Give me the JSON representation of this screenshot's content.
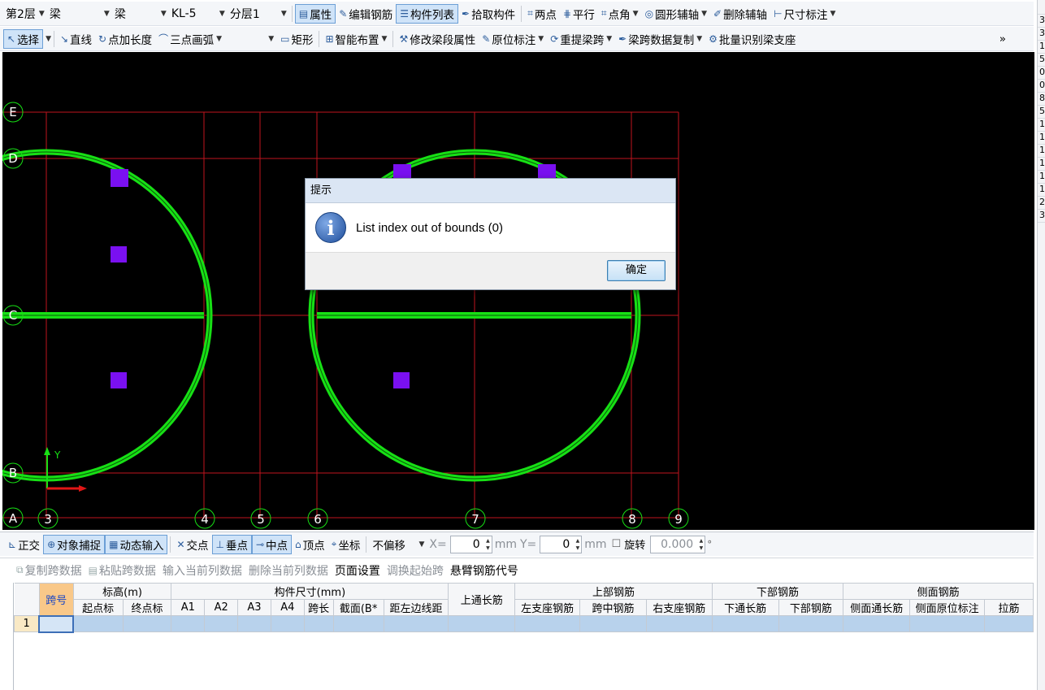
{
  "toolbar1": {
    "floor": "第2层",
    "type1": "梁",
    "type2": "梁",
    "component": "KL-5",
    "layer": "分层1",
    "properties": "属性",
    "edit_rebar": "编辑钢筋",
    "component_list": "构件列表",
    "pick_component": "拾取构件",
    "two_points": "两点",
    "parallel": "平行",
    "point_angle": "点角",
    "circle_axis": "圆形辅轴",
    "delete_axis": "删除辅轴",
    "dimension": "尺寸标注"
  },
  "toolbar2": {
    "select": "选择",
    "line": "直线",
    "point_length": "点加长度",
    "three_point_arc": "三点画弧",
    "rectangle": "矩形",
    "smart_layout": "智能布置",
    "modify_span_props": "修改梁段属性",
    "in_situ_label": "原位标注",
    "re_span": "重提梁跨",
    "span_copy": "梁跨数据复制",
    "batch_identify": "批量识别梁支座",
    "more": "»"
  },
  "canvas": {
    "axis_labels_bottom": [
      "3",
      "4",
      "5",
      "6",
      "7",
      "8",
      "9"
    ],
    "axis_labels_left": [
      "E",
      "D",
      "C",
      "B",
      "A"
    ],
    "ucs_y": "Y",
    "colors": {
      "background": "#000000",
      "grid": "#c0141e",
      "beam": "#17e015",
      "column": "#7a10f0"
    }
  },
  "dialog": {
    "title": "提示",
    "message": "List index out of bounds (0)",
    "ok": "确定",
    "icon": "info-icon"
  },
  "snapbar": {
    "ortho": "正交",
    "object_snap": "对象捕捉",
    "dynamic_input": "动态输入",
    "intersection": "交点",
    "perpendicular": "垂点",
    "midpoint": "中点",
    "vertex": "顶点",
    "coordinate": "坐标",
    "offset": "不偏移",
    "x_label": "X=",
    "x_value": "0",
    "x_unit": "mm",
    "y_label": "Y=",
    "y_value": "0",
    "y_unit": "mm",
    "rotate": "旋转",
    "rotate_value": "0.000",
    "degree": "°"
  },
  "tablebar": {
    "copy_span": "复制跨数据",
    "paste_span": "粘贴跨数据",
    "input_col": "输入当前列数据",
    "delete_col": "删除当前列数据",
    "page_setup": "页面设置",
    "swap_start": "调换起始跨",
    "cantilever_code": "悬臂钢筋代号"
  },
  "grid": {
    "header1": [
      "跨号",
      "标高(m)",
      "构件尺寸(mm)",
      "上通长筋",
      "上部钢筋",
      "下部钢筋",
      "侧面钢筋"
    ],
    "header2": [
      "起点标",
      "终点标",
      "A1",
      "A2",
      "A3",
      "A4",
      "跨长",
      "截面(B*",
      "距左边线距",
      "左支座钢筋",
      "跨中钢筋",
      "右支座钢筋",
      "下通长筋",
      "下部钢筋",
      "侧面通长筋",
      "侧面原位标注",
      "拉筋"
    ],
    "rows": [
      {
        "index": "1"
      }
    ]
  },
  "rightstrip": [
    "3",
    "3",
    "1",
    "5",
    "0",
    "0",
    "8",
    "5",
    "1",
    "1",
    "1",
    "1",
    "1",
    "1",
    "2",
    "3"
  ]
}
